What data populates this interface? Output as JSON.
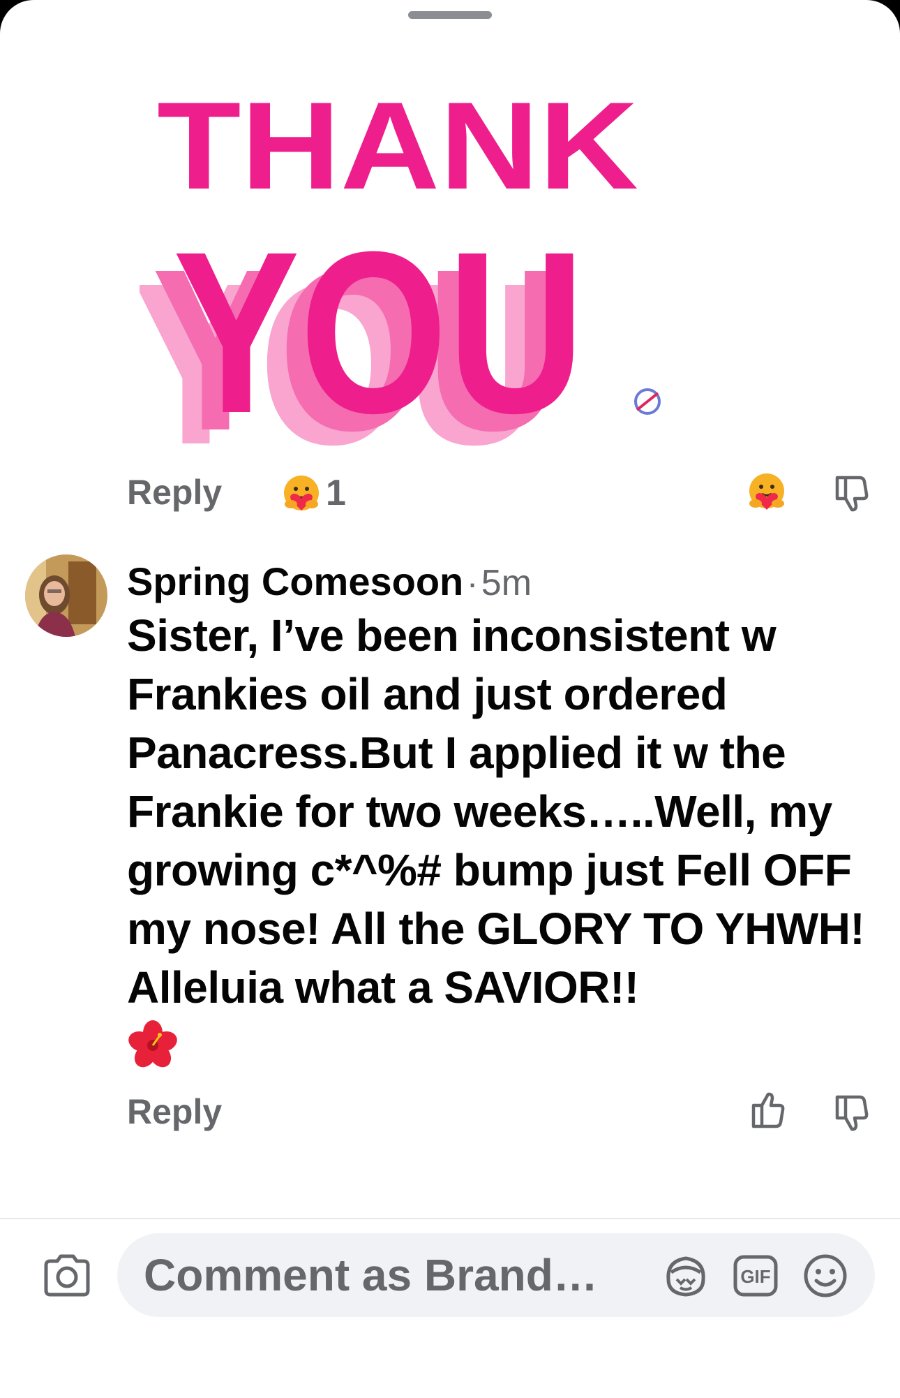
{
  "sticker": {
    "line1": "THANK",
    "line2": "YOU",
    "colors": {
      "primary": "#ee1e8c",
      "shade1": "#f56cb1",
      "shade2": "#f9a5cf",
      "badge": "#6a7bd6"
    }
  },
  "first_comment_actions": {
    "reply_label": "Reply",
    "reaction_icon": "care-hug-emoji-icon",
    "reaction_count": "1",
    "my_reaction_icon": "care-hug-emoji-icon",
    "dislike_icon": "thumbs-down-icon"
  },
  "comment": {
    "author": "Spring Comesoon",
    "separator": "·",
    "time": "5m",
    "text": "Sister, I’ve been inconsistent w Frankies oil and just ordered Panacress.But I applied it w the Frankie for two weeks…..Well, my growing c*^%# bump just Fell OFF my nose! All the GLORY TO YHWH! Alleluia what a SAVIOR!!",
    "emoji_icon": "hibiscus-emoji-icon",
    "reply_label": "Reply",
    "like_icon": "thumbs-up-icon",
    "dislike_icon": "thumbs-down-icon"
  },
  "composer": {
    "camera_icon": "camera-icon",
    "placeholder": "Comment as Brand…",
    "avatar_sticker_icon": "avatar-sticker-icon",
    "gif_label": "GIF",
    "emoji_icon": "smiley-icon"
  },
  "colors": {
    "secondary_text": "#65676b",
    "primary_text": "#050505",
    "input_bg": "#f0f2f5"
  }
}
